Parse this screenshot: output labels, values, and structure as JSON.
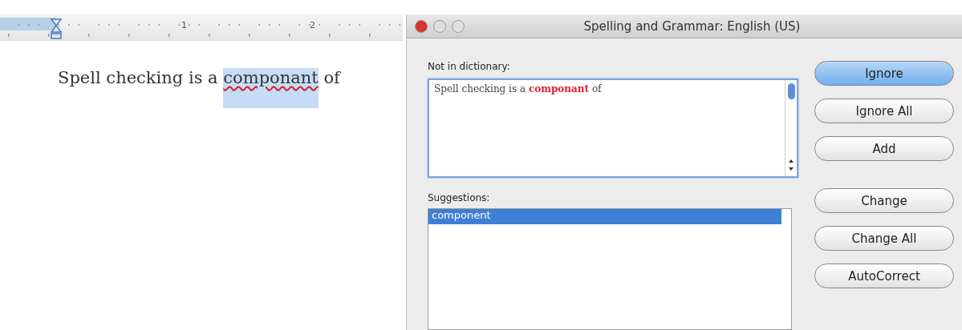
{
  "document": {
    "ruler_labels": [
      "1",
      "2"
    ],
    "sentence_start": "Spell checking is a",
    "misspelled_word": "componant",
    "sentence_end": "of"
  },
  "dialog": {
    "title": "Spelling and Grammar: English (US)",
    "not_in_dictionary": {
      "label": "Not in dictionary:",
      "text": "Spell checking is a **componant** of"
    },
    "suggestions": {
      "label": "Suggestions:",
      "items": [
        {
          "text": "component",
          "selected": true
        }
      ]
    },
    "buttons": [
      {
        "label": "Ignore",
        "default": true
      },
      {
        "label": "Ignore All",
        "default": false
      },
      {
        "label": "Add",
        "default": false
      },
      {
        "label": "Change",
        "default": false
      },
      {
        "label": "Change All",
        "default": false
      },
      {
        "label": "AutoCorrect",
        "default": false
      }
    ]
  }
}
